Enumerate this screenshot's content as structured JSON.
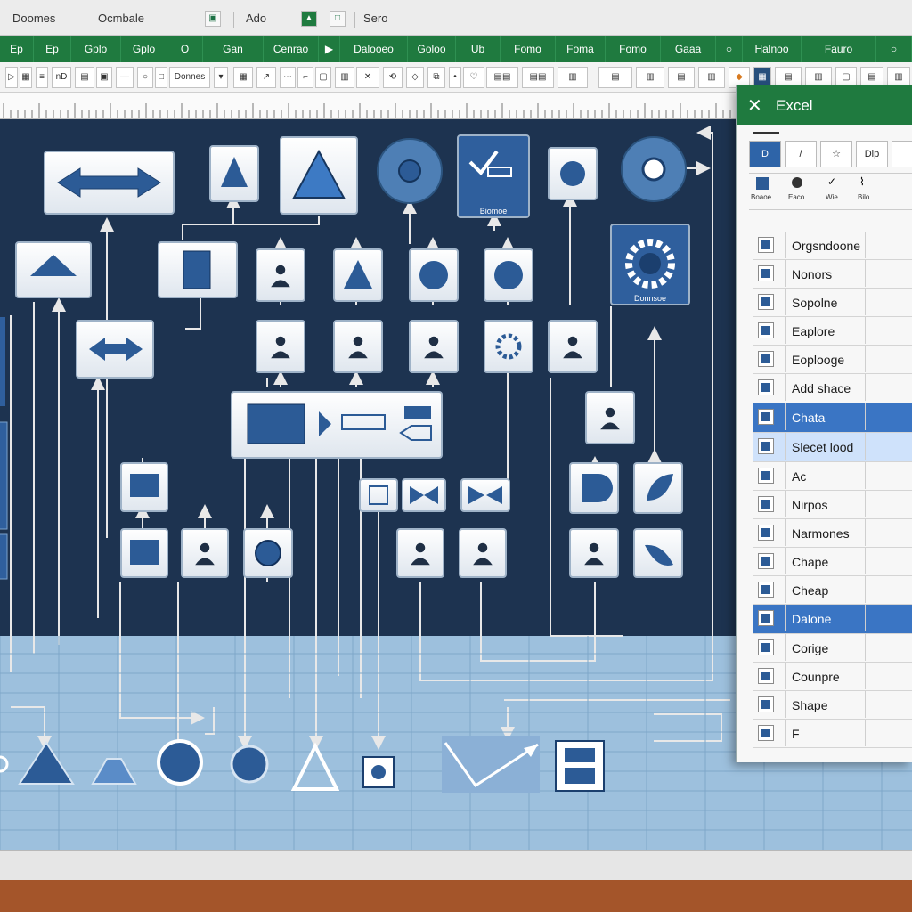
{
  "title_bar": {
    "items": [
      "Doomes",
      "Ocmbale",
      "Ado",
      "Sero"
    ]
  },
  "ribbon_tabs": [
    "Ep",
    "Ep",
    "Gplo",
    "Gplo",
    "O",
    "Gan",
    "Cenrao",
    "Dalooeo",
    "Goloo",
    "Ub",
    "Fomo",
    "Foma",
    "Fomo",
    "Gaaa",
    "Halnoo",
    "Fauro"
  ],
  "ribbon_tools": {
    "shapes_label": "Donnes"
  },
  "diagram": {
    "badges": [
      "Biomoe",
      "Donnsoe"
    ]
  },
  "panel": {
    "title": "Excel",
    "tools": [
      "D",
      "/",
      "☆",
      "Dip"
    ],
    "subtools": [
      "Boaoe",
      "Eaco",
      "Wie",
      "Bilo"
    ],
    "items": [
      {
        "label": "Orgsndoone",
        "state": "normal"
      },
      {
        "label": "Nonors",
        "state": "normal"
      },
      {
        "label": "Sopolne",
        "state": "normal"
      },
      {
        "label": "Eaplore",
        "state": "normal"
      },
      {
        "label": "Eoplooge",
        "state": "normal"
      },
      {
        "label": "Add shace",
        "state": "normal"
      },
      {
        "label": "Chata",
        "state": "selected"
      },
      {
        "label": "Slecet lood",
        "state": "highlight"
      },
      {
        "label": "Ac",
        "state": "normal"
      },
      {
        "label": "Nirpos",
        "state": "normal"
      },
      {
        "label": "Narmones",
        "state": "normal"
      },
      {
        "label": "Chape",
        "state": "normal"
      },
      {
        "label": "Cheap",
        "state": "normal"
      },
      {
        "label": "Dalone",
        "state": "selected"
      },
      {
        "label": "Corige",
        "state": "normal"
      },
      {
        "label": "Counpre",
        "state": "normal"
      },
      {
        "label": "Shape",
        "state": "normal"
      },
      {
        "label": "F",
        "state": "normal"
      }
    ]
  },
  "colors": {
    "ribbon_green": "#1f7a3f",
    "canvas_navy": "#1d3350",
    "shape_blue": "#2c5b96",
    "selection_blue": "#3a75c4",
    "grid_blue": "#9dc0dd"
  }
}
